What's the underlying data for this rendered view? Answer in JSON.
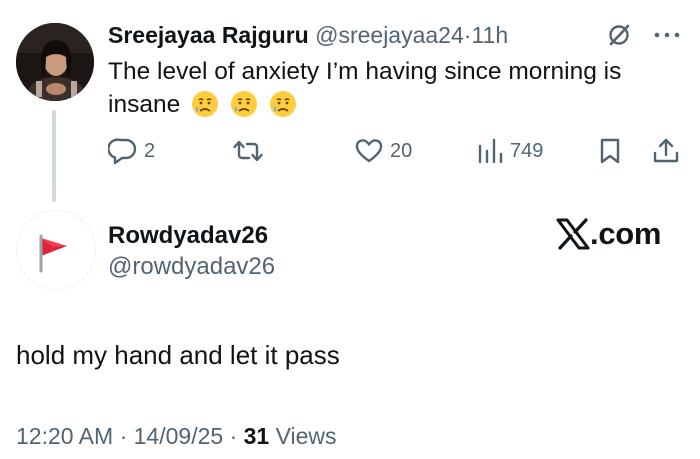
{
  "parent_tweet": {
    "display_name": "Sreejayaa Rajguru",
    "handle": "@sreejayaa24",
    "separator": "·",
    "time_ago": "11h",
    "text": "The level of anxiety I’m having since morning is insane",
    "emojis": [
      "sad-but-relieved-face",
      "sad-but-relieved-face",
      "sad-but-relieved-face"
    ],
    "actions": {
      "reply_count": "2",
      "like_count": "20",
      "view_count": "749"
    }
  },
  "reply_tweet": {
    "display_name": "Rowdyadav26",
    "handle": "@rowdyadav26",
    "text": "hold my hand and let it pass",
    "avatar_icon": "red-flag-icon",
    "time": "12:20 AM",
    "separator": "·",
    "date": "14/09/25",
    "views_count": "31",
    "views_label": "Views"
  },
  "branding": {
    "brand_text": ".com"
  },
  "colors": {
    "text_primary": "#0f1419",
    "text_muted": "#536471",
    "thread_line": "#cfd9de",
    "flag_red": "#e0223a",
    "emoji_yellow": "#ffcc3d",
    "tear_blue": "#5aaeef"
  }
}
